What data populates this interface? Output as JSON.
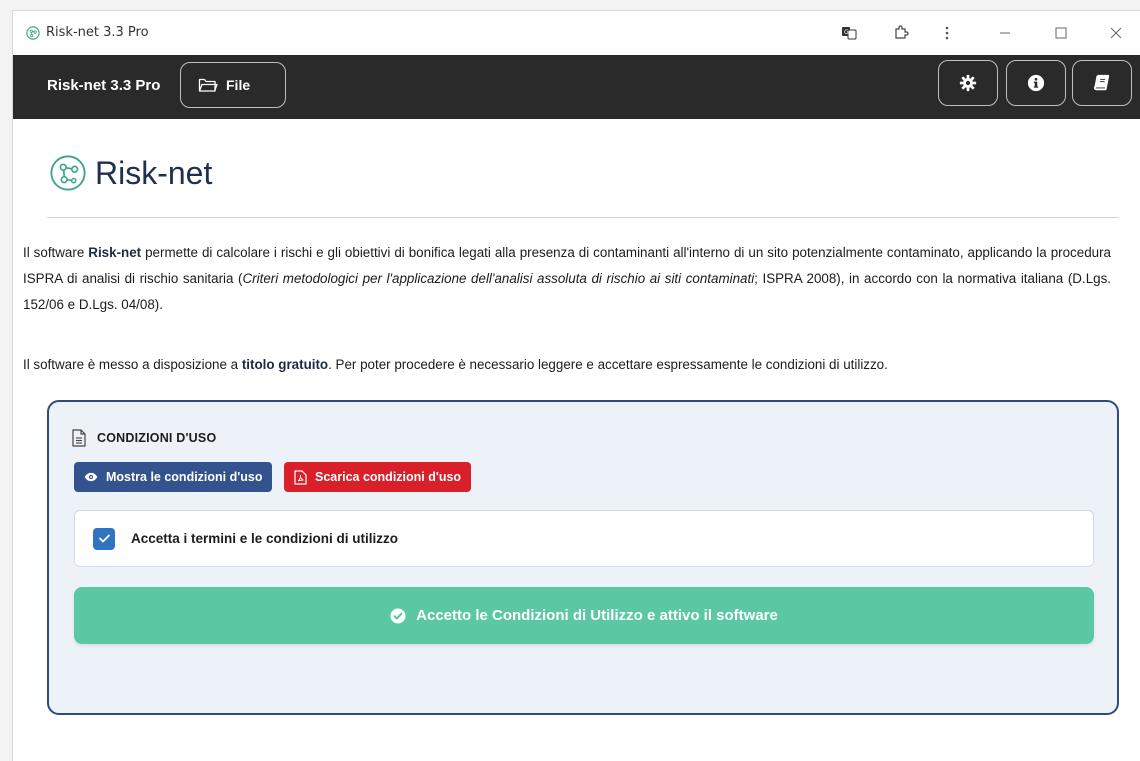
{
  "window": {
    "title": "Risk-net 3.3 Pro"
  },
  "navbar": {
    "brand": "Risk-net 3.3 Pro",
    "file_label": "File",
    "icons": [
      "gear-icon",
      "info-icon",
      "book-icon"
    ]
  },
  "header": {
    "logo_text": "Risk-net"
  },
  "intro": {
    "p1_a": "Il software ",
    "p1_b": "Risk-net",
    "p1_c": " permette di calcolare i rischi e gli obiettivi di bonifica legati alla presenza di contaminanti all'interno di un sito potenzialmente contaminato, applicando la procedura ISPRA di analisi di rischio sanitaria (",
    "p1_d": "Criteri metodologici per l'applicazione dell'analisi assoluta di rischio ai siti contaminati",
    "p1_e": "; ISPRA 2008), in accordo con la normativa italiana (D.Lgs. 152/06 e D.Lgs. 04/08).",
    "p2_a": "Il software è messo a disposizione a ",
    "p2_b": "titolo gratuito",
    "p2_c": ". Per poter procedere è necessario leggere e accettare espressamente le condizioni di utilizzo."
  },
  "card": {
    "title": "CONDIZIONI D'USO",
    "show_label": "Mostra le condizioni d'uso",
    "download_label": "Scarica condizioni d'uso",
    "checkbox_label": "Accetta i termini e le condizioni di utilizzo",
    "checkbox_checked": true,
    "accept_label": "Accetto le Condizioni di Utilizzo e attivo il software"
  },
  "colors": {
    "navbar": "#2a2a2a",
    "primary": "#34538e",
    "danger": "#d91f2a",
    "success": "#5bc7a3",
    "checkbox": "#2f74c0"
  }
}
